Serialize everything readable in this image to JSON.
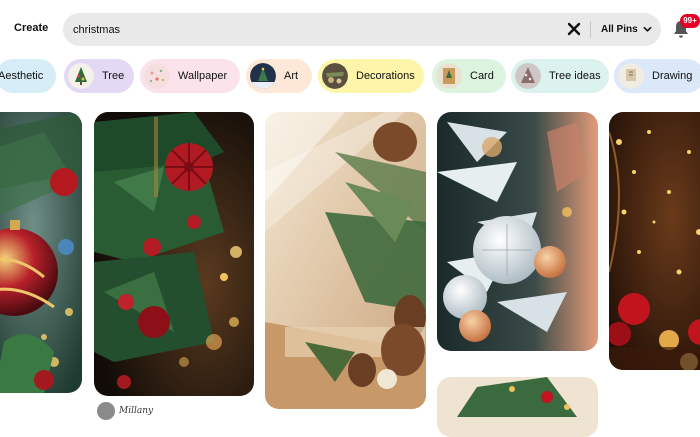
{
  "header": {
    "create_label": "Create",
    "search_value": "christmas",
    "filter_label": "All Pins",
    "notification_count": "99+"
  },
  "chips": [
    {
      "label": "Aesthetic",
      "bg": "#d6ecf7"
    },
    {
      "label": "Tree",
      "bg": "#e4d9f5"
    },
    {
      "label": "Wallpaper",
      "bg": "#fbe3ec"
    },
    {
      "label": "Art",
      "bg": "#fde7d6"
    },
    {
      "label": "Decorations",
      "bg": "#fdf5a9"
    },
    {
      "label": "Card",
      "bg": "#dcf3df"
    },
    {
      "label": "Tree ideas",
      "bg": "#dcf2ef"
    },
    {
      "label": "Drawing",
      "bg": "#dbe8f8"
    }
  ],
  "pins": {
    "author_name": "Millany"
  },
  "colors": {
    "accent": "#e60023",
    "search_bg": "#e9e9e9"
  }
}
